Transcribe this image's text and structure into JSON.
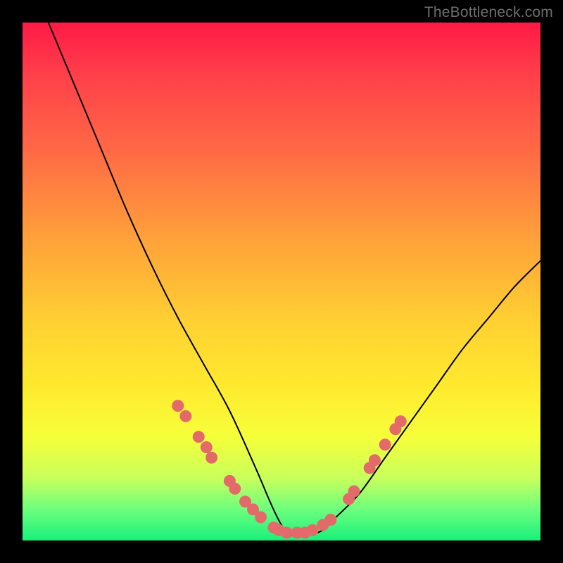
{
  "watermark": "TheBottleneck.com",
  "chart_data": {
    "type": "line",
    "title": "",
    "xlabel": "",
    "ylabel": "",
    "xlim": [
      0,
      100
    ],
    "ylim": [
      0,
      100
    ],
    "series": [
      {
        "name": "bottleneck-curve",
        "x": [
          5,
          10,
          15,
          20,
          25,
          30,
          35,
          40,
          45,
          48,
          50,
          52,
          55,
          58,
          60,
          65,
          70,
          75,
          80,
          85,
          90,
          95,
          100
        ],
        "values": [
          100,
          88,
          76,
          64,
          53,
          43,
          34,
          25,
          14,
          7,
          3,
          1,
          1,
          2,
          4,
          9,
          16,
          23,
          30,
          37,
          43,
          49,
          54
        ]
      }
    ],
    "markers": {
      "name": "salmon-dots",
      "color": "#e46a6a",
      "points": [
        {
          "x": 30,
          "y": 26
        },
        {
          "x": 31.5,
          "y": 24
        },
        {
          "x": 34,
          "y": 20
        },
        {
          "x": 35.5,
          "y": 18
        },
        {
          "x": 36.5,
          "y": 16
        },
        {
          "x": 40,
          "y": 11.5
        },
        {
          "x": 41,
          "y": 10
        },
        {
          "x": 43,
          "y": 7.5
        },
        {
          "x": 44.5,
          "y": 6
        },
        {
          "x": 46,
          "y": 4.5
        },
        {
          "x": 48.5,
          "y": 2.5
        },
        {
          "x": 49.5,
          "y": 2
        },
        {
          "x": 51,
          "y": 1.5
        },
        {
          "x": 53,
          "y": 1.5
        },
        {
          "x": 54.5,
          "y": 1.5
        },
        {
          "x": 56,
          "y": 2
        },
        {
          "x": 58,
          "y": 3
        },
        {
          "x": 59.5,
          "y": 4
        },
        {
          "x": 63,
          "y": 8
        },
        {
          "x": 64,
          "y": 9.5
        },
        {
          "x": 67,
          "y": 14
        },
        {
          "x": 68,
          "y": 15.5
        },
        {
          "x": 70,
          "y": 18.5
        },
        {
          "x": 72,
          "y": 21.5
        },
        {
          "x": 73,
          "y": 23
        }
      ]
    }
  }
}
